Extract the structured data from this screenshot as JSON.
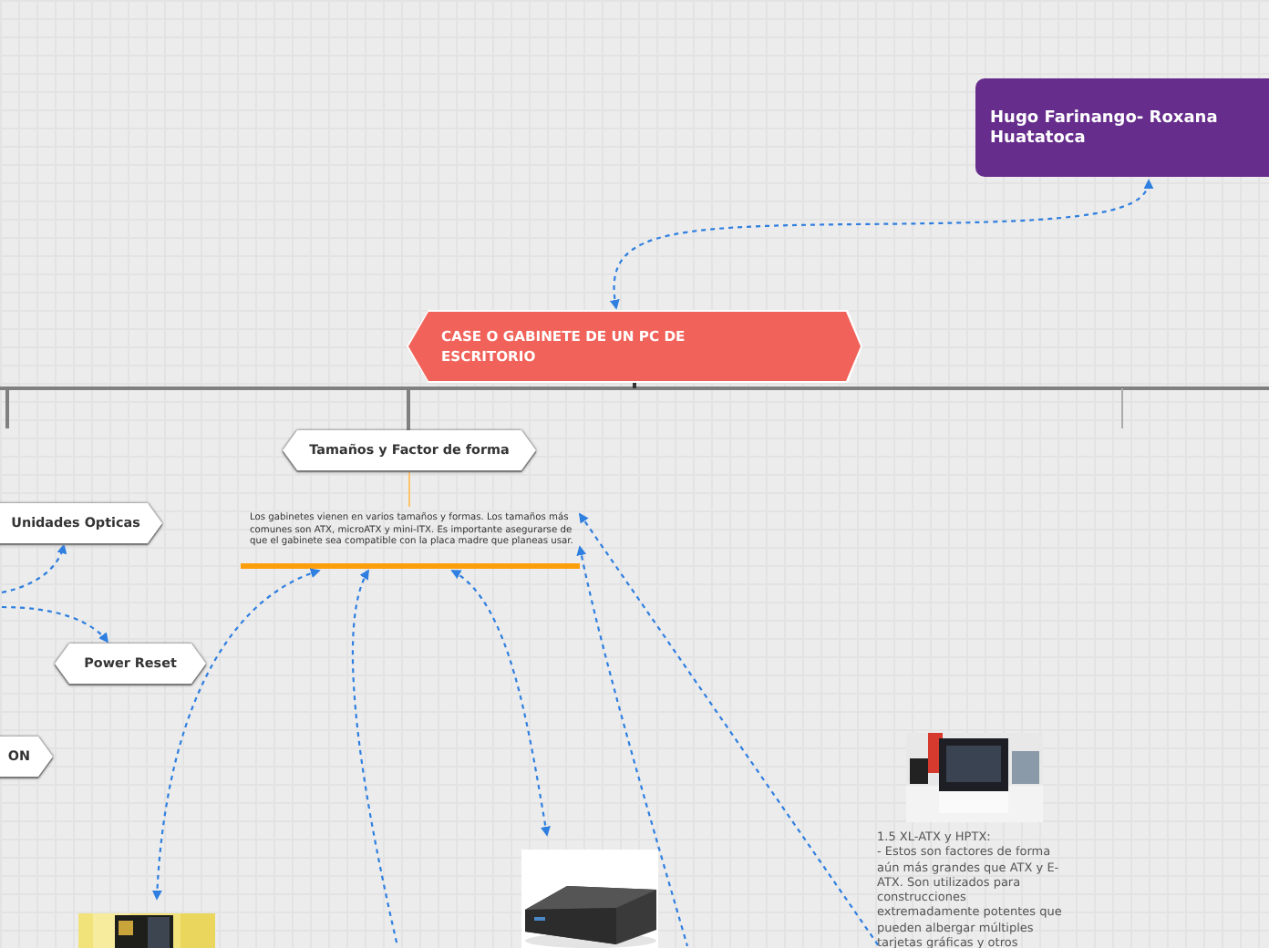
{
  "authors_node": {
    "text": "Hugo Farinango- Roxana Huatatoca"
  },
  "central_node": {
    "text": "CASE O GABINETE DE UN PC DE ESCRITORIO"
  },
  "topics": [
    {
      "label": "Tamaños y Factor de forma"
    },
    {
      "label": "Unidades Opticas"
    },
    {
      "label": "Power Reset"
    },
    {
      "label": "ON"
    }
  ],
  "description": "Los gabinetes vienen en varios tamaños y formas. Los tamaños más comunes son ATX, microATX y mini-ITX. Es importante asegurarse de que el gabinete sea compatible con la placa madre que planeas usar.",
  "note": "1.5 XL-ATX y HPTX:\n - Estos son factores de forma aún más grandes que ATX y E-ATX. Son utilizados para construcciones extremadamente potentes que pueden albergar múltiples tarjetas gráficas y otros"
}
